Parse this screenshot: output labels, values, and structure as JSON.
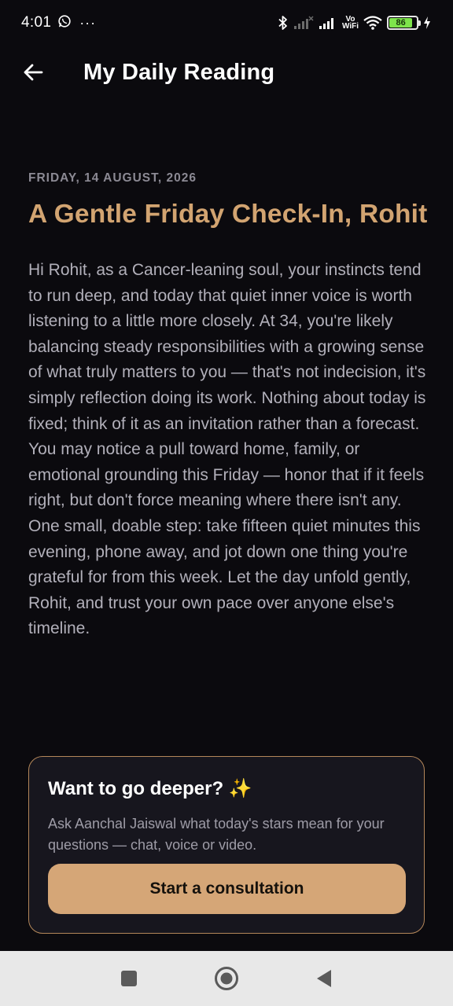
{
  "status_bar": {
    "time": "4:01",
    "overflow": "···",
    "network_label_top": "Vo",
    "network_label_bottom": "WiFi",
    "battery_level": "86",
    "icons": [
      "whatsapp-icon",
      "bluetooth-icon",
      "signal-icon",
      "wifi-icon",
      "battery-icon",
      "charging-icon"
    ]
  },
  "header": {
    "title": "My Daily Reading",
    "back_icon": "arrow-left-icon"
  },
  "reading": {
    "date": "FRIDAY, 14 AUGUST, 2026",
    "title": "A Gentle Friday Check-In, Rohit",
    "body": "Hi Rohit, as a Cancer-leaning soul, your instincts tend to run deep, and today that quiet inner voice is worth listening to a little more closely. At 34, you're likely balancing steady responsibilities with a growing sense of what truly matters to you — that's not indecision, it's simply reflection doing its work. Nothing about today is fixed; think of it as an invitation rather than a forecast. You may notice a pull toward home, family, or emotional grounding this Friday — honor that if it feels right, but don't force meaning where there isn't any. One small, doable step: take fifteen quiet minutes this evening, phone away, and jot down one thing you're grateful for from this week. Let the day unfold gently, Rohit, and trust your own pace over anyone else's timeline."
  },
  "cta": {
    "title": "Want to go deeper? ✨",
    "description": "Ask Aanchal Jaiswal what today's stars mean for your questions — chat, voice or video.",
    "button_label": "Start a consultation"
  },
  "nav_bar": {
    "icons": [
      "recents-square-icon",
      "home-circle-icon",
      "back-triangle-icon"
    ]
  },
  "colors": {
    "background": "#0b0a0e",
    "accent": "#d2a471",
    "card_border": "#b4875a",
    "button": "#d5a677"
  }
}
